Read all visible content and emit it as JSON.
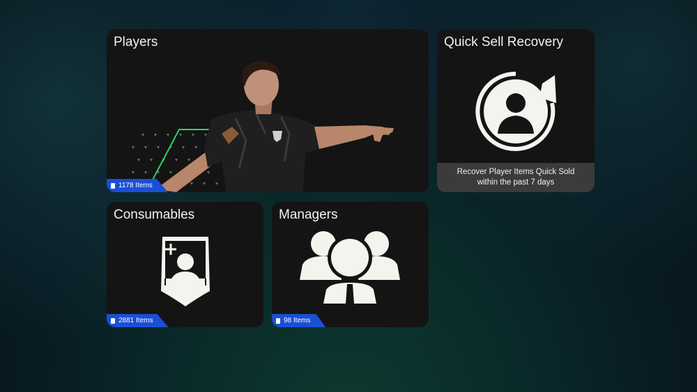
{
  "tiles": {
    "players": {
      "title": "Players",
      "count_label": "1178 Items"
    },
    "quick_sell_recovery": {
      "title": "Quick Sell Recovery",
      "caption_line1": "Recover Player Items Quick Sold",
      "caption_line2": "within the past 7 days"
    },
    "consumables": {
      "title": "Consumables",
      "count_label": "2881 Items"
    },
    "managers": {
      "title": "Managers",
      "count_label": "98 Items"
    }
  },
  "colors": {
    "tile_bg": "#141414",
    "badge_blue": "#1a4fd6",
    "caption_bg": "#3b3b3b",
    "icon_white": "#f5f3ee",
    "accent_green": "#2bd36a"
  },
  "icons": {
    "players": "player-photo",
    "quick_sell_recovery": "user-refresh-icon",
    "consumables": "player-card-plus-icon",
    "managers": "manager-group-icon"
  }
}
